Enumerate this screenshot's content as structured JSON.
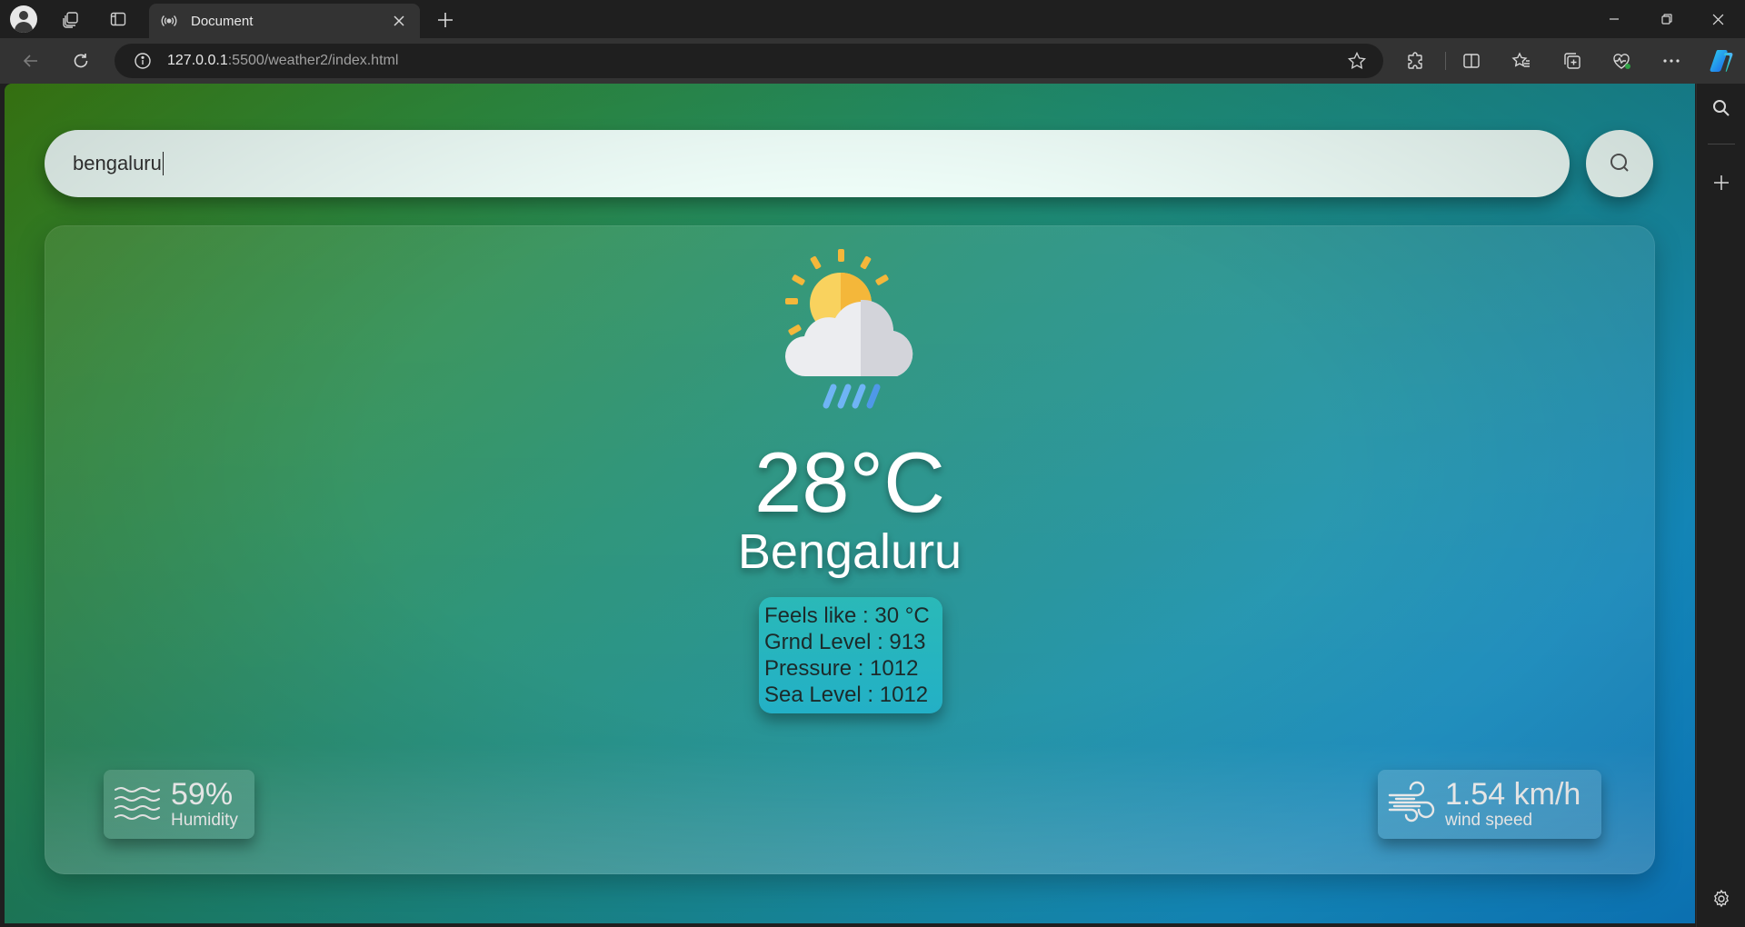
{
  "browser": {
    "tab_title": "Document",
    "url_host": "127.0.0.1",
    "url_rest": ":5500/weather2/index.html"
  },
  "search": {
    "value": "bengaluru"
  },
  "weather": {
    "icon": "partly-cloudy-rain-icon",
    "temperature": "28°C",
    "city": "Bengaluru",
    "details": [
      "Feels like : 30 °C",
      "Grnd Level : 913",
      "Pressure : 1012",
      "Sea Level : 1012"
    ],
    "humidity": {
      "value": "59%",
      "label": "Humidity",
      "icon": "waves-icon"
    },
    "wind": {
      "value": "1.54 km/h",
      "label": "wind speed",
      "icon": "wind-icon"
    }
  },
  "colors": {
    "gradient_start": "#3e8313",
    "gradient_end": "#0e88d6",
    "search_bg": "#eefdf8",
    "details_bg": "#2ab9b8"
  }
}
